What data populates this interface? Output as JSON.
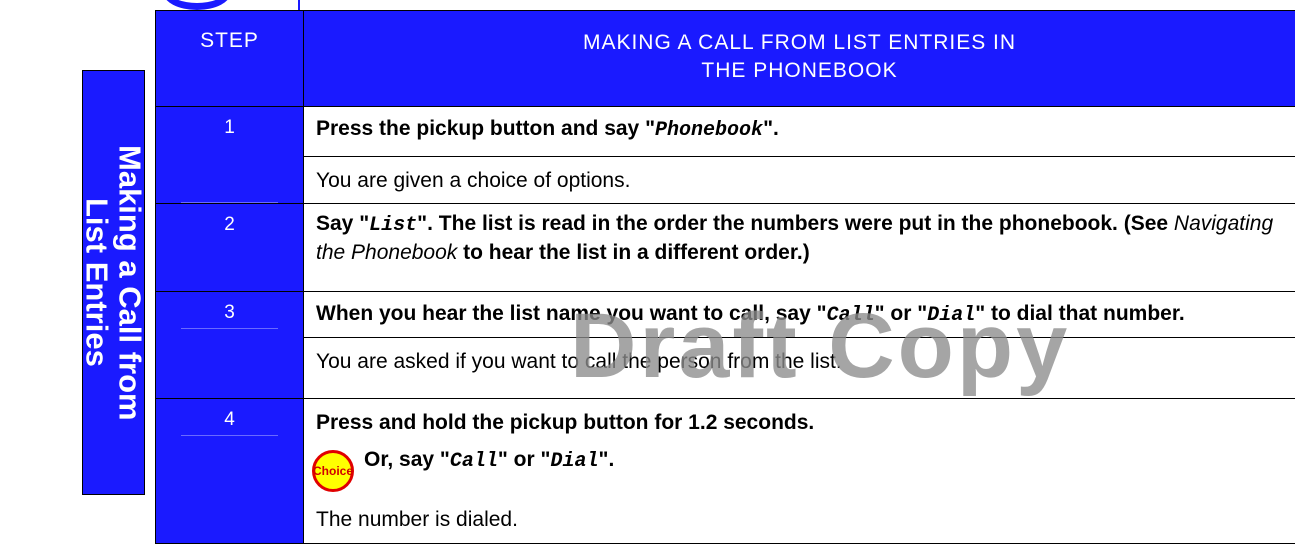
{
  "side_label": "Making a Call from\nList Entries",
  "table": {
    "header_step": "STEP",
    "header_title": "MAKING A CALL FROM LIST ENTRIES IN\nTHE PHONEBOOK",
    "rows": [
      {
        "number": "1",
        "instruction_a": "Press the pickup button and say \"",
        "instruction_cmd": "Phonebook",
        "instruction_b": "\".",
        "result": "You are given a choice of options."
      },
      {
        "number": "2",
        "instruction_a": "Say \"",
        "instruction_cmd": "List",
        "instruction_b": "\". The list is read in the order the numbers were put in the phonebook. (See ",
        "instruction_link": "Navigating the Phonebook",
        "instruction_c": " to hear the list in a different order.)"
      },
      {
        "number": "3",
        "instruction_a": "When you hear the list name you want to call, say \"",
        "instruction_cmd1": "Call",
        "instruction_b": "\" or \"",
        "instruction_cmd2": "Dial",
        "instruction_c": "\" to dial that number.",
        "result": "You are asked if you want to call the person from the list."
      },
      {
        "number": "4",
        "instruction": "Press and hold the pickup button for 1.2 seconds.",
        "choice_badge": "Choice",
        "choice_a": "Or, say \"",
        "choice_cmd1": "Call",
        "choice_b": "\" or \"",
        "choice_cmd2": "Dial",
        "choice_c": "\".",
        "result": "The number is dialed."
      }
    ]
  },
  "watermark": "Draft Copy",
  "colors": {
    "accent": "#1a1aff",
    "badge_fill": "#ffff00",
    "badge_ring": "#e00000"
  }
}
